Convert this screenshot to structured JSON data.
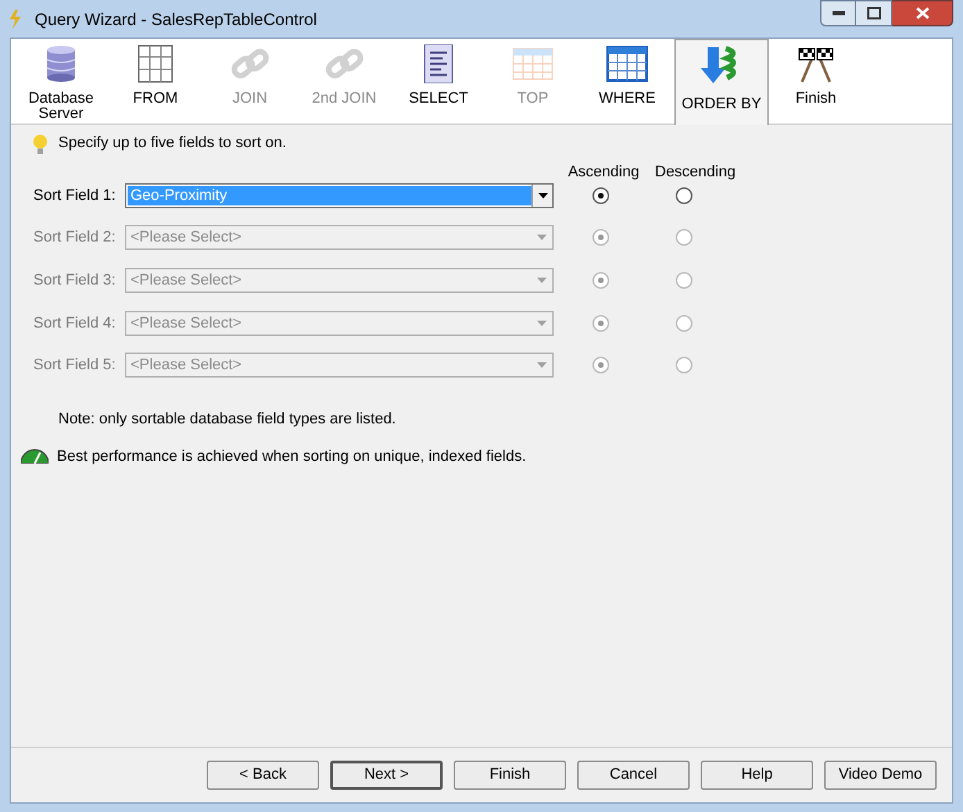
{
  "window": {
    "title": "Query Wizard - SalesRepTableControl"
  },
  "toolbar": [
    {
      "kind": "database",
      "label": "Database Server",
      "disabled": false,
      "selected": false
    },
    {
      "kind": "grid",
      "label": "FROM",
      "disabled": false,
      "selected": false
    },
    {
      "kind": "link",
      "label": "JOIN",
      "disabled": true,
      "selected": false
    },
    {
      "kind": "link",
      "label": "2nd JOIN",
      "disabled": true,
      "selected": false
    },
    {
      "kind": "list",
      "label": "SELECT",
      "disabled": false,
      "selected": false
    },
    {
      "kind": "calendar",
      "label": "TOP",
      "disabled": true,
      "selected": false
    },
    {
      "kind": "table",
      "label": "WHERE",
      "disabled": false,
      "selected": false
    },
    {
      "kind": "order",
      "label": "ORDER BY",
      "disabled": false,
      "selected": true
    },
    {
      "kind": "flags",
      "label": "Finish",
      "disabled": false,
      "selected": false
    }
  ],
  "hint": "Specify up to five fields to sort on.",
  "columns": [
    "Ascending",
    "Descending"
  ],
  "sort_fields": [
    {
      "label": "Sort Field 1:",
      "value": "Geo-Proximity",
      "disabled": false,
      "ascending": true,
      "descending": false
    },
    {
      "label": "Sort Field 2:",
      "value": "<Please Select>",
      "disabled": true,
      "ascending": true,
      "descending": false
    },
    {
      "label": "Sort Field 3:",
      "value": "<Please Select>",
      "disabled": true,
      "ascending": true,
      "descending": false
    },
    {
      "label": "Sort Field 4:",
      "value": "<Please Select>",
      "disabled": true,
      "ascending": true,
      "descending": false
    },
    {
      "label": "Sort Field 5:",
      "value": "<Please Select>",
      "disabled": true,
      "ascending": true,
      "descending": false
    }
  ],
  "note": "Note: only sortable database field types are listed.",
  "tip": "Best performance is achieved when sorting on unique, indexed fields.",
  "buttons": [
    {
      "label": "< Back",
      "default": false
    },
    {
      "label": "Next >",
      "default": true
    },
    {
      "label": "Finish",
      "default": false
    },
    {
      "label": "Cancel",
      "default": false
    },
    {
      "label": "Help",
      "default": false
    },
    {
      "label": "Video Demo",
      "default": false
    }
  ]
}
